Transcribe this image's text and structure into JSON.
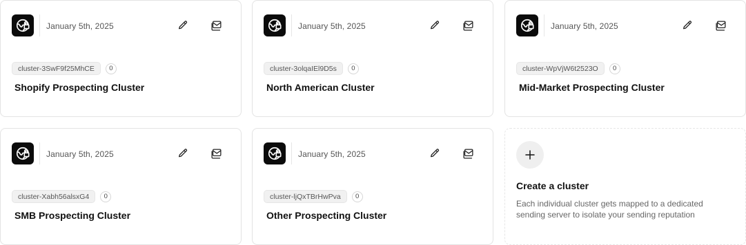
{
  "clusters": [
    {
      "date": "January 5th, 2025",
      "id": "cluster-3SwF9f25MhCE",
      "count": "0",
      "name": "Shopify Prospecting Cluster"
    },
    {
      "date": "January 5th, 2025",
      "id": "cluster-3olqaIEl9D5s",
      "count": "0",
      "name": "North American Cluster"
    },
    {
      "date": "January 5th, 2025",
      "id": "cluster-WpVjW6t2523O",
      "count": "0",
      "name": "Mid-Market Prospecting Cluster"
    },
    {
      "date": "January 5th, 2025",
      "id": "cluster-Xabh56alsxG4",
      "count": "0",
      "name": "SMB Prospecting Cluster"
    },
    {
      "date": "January 5th, 2025",
      "id": "cluster-ljQxTBrHwPva",
      "count": "0",
      "name": "Other Prospecting Cluster"
    }
  ],
  "create": {
    "title": "Create a cluster",
    "description": "Each individual cluster gets mapped to a dedicated sending server to isolate your sending reputation"
  },
  "icons": {
    "logo": "globe-icon",
    "edit": "pencil-icon",
    "mail": "mail-stack-icon",
    "add": "plus-icon"
  },
  "colors": {
    "logo_bg": "#0b0b0b",
    "chip_bg": "#f1f1f1",
    "border": "#e3e3e3"
  }
}
